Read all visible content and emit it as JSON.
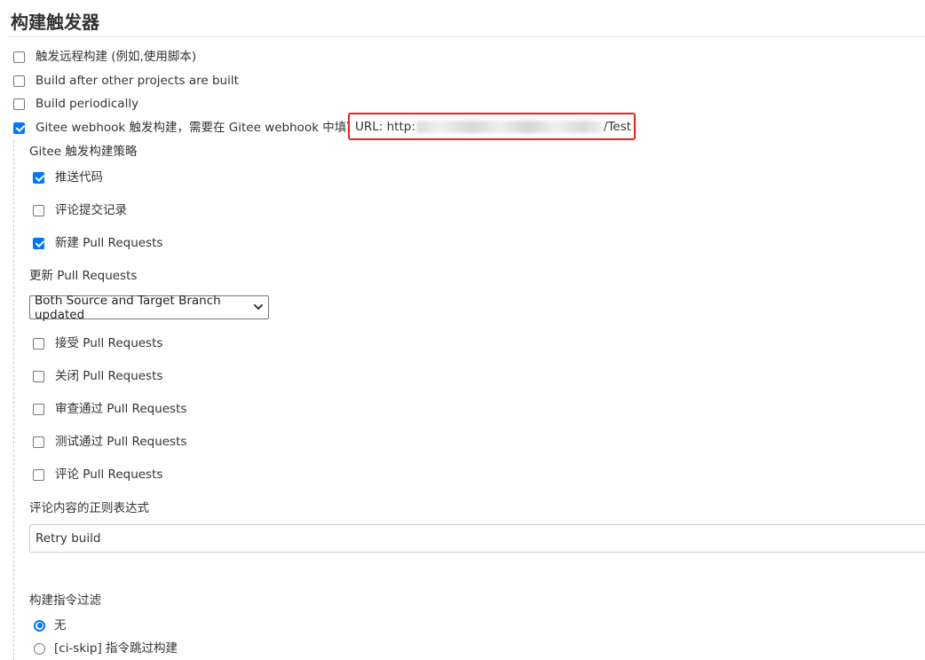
{
  "section": {
    "title": "构建触发器"
  },
  "triggers": [
    {
      "label": "触发远程构建 (例如,使用脚本)",
      "checked": false
    },
    {
      "label": "Build after other projects are built",
      "checked": false
    },
    {
      "label": "Build periodically",
      "checked": false
    },
    {
      "label": "Gitee webhook 触发构建，需要在 Gitee webhook 中填写",
      "checked": true
    }
  ],
  "webhook": {
    "url_prefix": "URL: http:",
    "url_suffix": "/Test"
  },
  "strategy": {
    "heading": "Gitee 触发构建策略",
    "options_top": [
      {
        "label": "推送代码",
        "checked": true
      },
      {
        "label": "评论提交记录",
        "checked": false
      },
      {
        "label": "新建 Pull Requests",
        "checked": true
      }
    ],
    "update_pr": {
      "label": "更新 Pull Requests",
      "selected": "Both Source and Target Branch updated"
    },
    "options_bottom": [
      {
        "label": "接受 Pull Requests",
        "checked": false
      },
      {
        "label": "关闭 Pull Requests",
        "checked": false
      },
      {
        "label": "审查通过 Pull Requests",
        "checked": false
      },
      {
        "label": "测试通过 Pull Requests",
        "checked": false
      },
      {
        "label": "评论 Pull Requests",
        "checked": false
      }
    ]
  },
  "comment_regex": {
    "label": "评论内容的正则表达式",
    "value": "Retry build"
  },
  "build_filter": {
    "label": "构建指令过滤",
    "options": [
      {
        "label": "无",
        "selected": true
      },
      {
        "label": "[ci-skip] 指令跳过构建",
        "selected": false
      }
    ]
  },
  "colors": {
    "accent": "#0075ff",
    "highlight_border": "#e8231f"
  }
}
